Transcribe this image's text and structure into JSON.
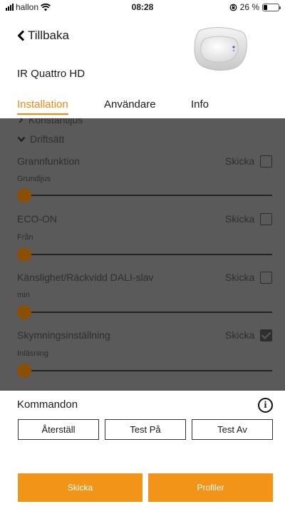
{
  "status_bar": {
    "carrier": "hallon",
    "time": "08:28",
    "battery_percent": "26 %",
    "battery_level": 0.26
  },
  "header": {
    "back_label": "Tillbaka",
    "device_name": "IR Quattro HD"
  },
  "tabs": [
    {
      "label": "Installation",
      "active": true
    },
    {
      "label": "Användare",
      "active": false
    },
    {
      "label": "Info",
      "active": false
    }
  ],
  "settings": {
    "partial_label": "Konstantljus",
    "section_label": "Driftsätt",
    "items": [
      {
        "title": "Grannfunktion",
        "value": "Grundljus",
        "send_label": "Skicka",
        "send_checked": false,
        "slider_value": 0
      },
      {
        "title": "ECO-ON",
        "value": "Från",
        "send_label": "Skicka",
        "send_checked": false,
        "slider_value": 0
      },
      {
        "title": "Känslighet/Räckvidd DALI-slav",
        "value": "min",
        "send_label": "Skicka",
        "send_checked": false,
        "slider_value": 0
      },
      {
        "title": "Skymningsinställning",
        "value": "Inläsning",
        "send_label": "Skicka",
        "send_checked": true,
        "slider_value": 0
      }
    ]
  },
  "commands": {
    "label": "Kommandon",
    "buttons": [
      "Återställ",
      "Test På",
      "Test Av"
    ]
  },
  "footer": {
    "send_label": "Skicka",
    "profiles_label": "Profiler"
  },
  "colors": {
    "accent": "#ee8a10",
    "button_orange": "#f19418",
    "overlay": "#5a5a5a"
  }
}
